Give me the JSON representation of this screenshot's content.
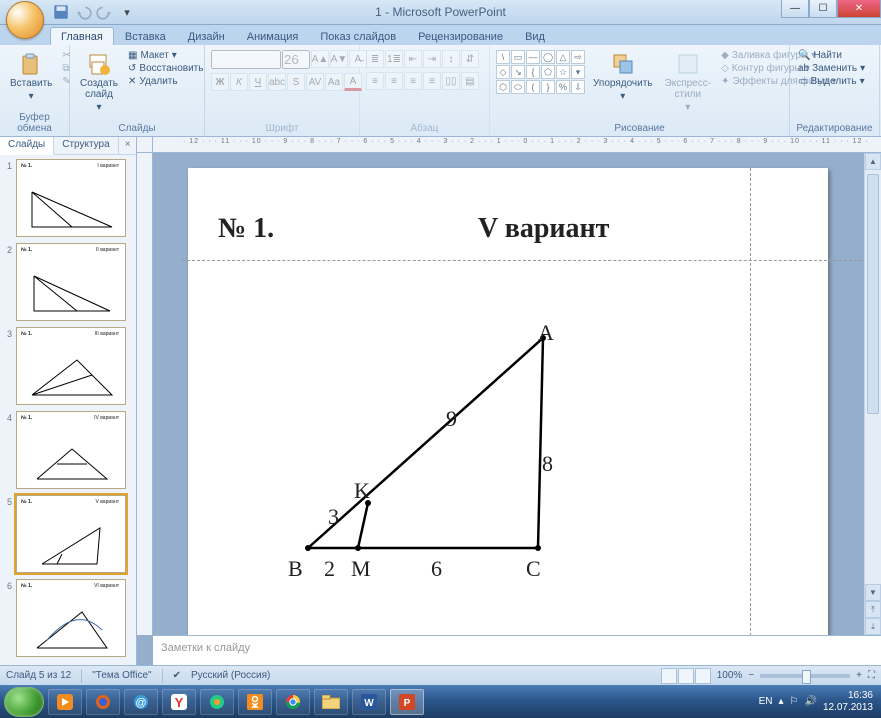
{
  "app": {
    "title": "1 - Microsoft PowerPoint"
  },
  "tabs": {
    "items": [
      "Главная",
      "Вставка",
      "Дизайн",
      "Анимация",
      "Показ слайдов",
      "Рецензирование",
      "Вид"
    ],
    "active": 0
  },
  "ribbon": {
    "clipboard": {
      "label": "Буфер обмена",
      "paste": "Вставить"
    },
    "slides": {
      "label": "Слайды",
      "create": "Создать\nслайд",
      "layout": "Макет",
      "reset": "Восстановить",
      "delete": "Удалить"
    },
    "font": {
      "label": "Шрифт",
      "name_placeholder": "",
      "size_placeholder": "26"
    },
    "para": {
      "label": "Абзац"
    },
    "drawing": {
      "label": "Рисование",
      "arrange": "Упорядочить",
      "styles": "Экспресс-стили",
      "fill": "Заливка фигуры",
      "outline": "Контур фигуры",
      "effects": "Эффекты для фигур"
    },
    "editing": {
      "label": "Редактирование",
      "find": "Найти",
      "replace": "Заменить",
      "select": "Выделить"
    }
  },
  "panel": {
    "tab_slides": "Слайды",
    "tab_structure": "Структура"
  },
  "thumbs": [
    {
      "num": "1",
      "title": "№ 1.",
      "variant": "I вариант"
    },
    {
      "num": "2",
      "title": "№ 1.",
      "variant": "II вариант"
    },
    {
      "num": "3",
      "title": "№ 1.",
      "variant": "III вариант"
    },
    {
      "num": "4",
      "title": "№ 1.",
      "variant": "IV вариант"
    },
    {
      "num": "5",
      "title": "№ 1.",
      "variant": "V вариант"
    },
    {
      "num": "6",
      "title": "№ 1.",
      "variant": "VI вариант"
    }
  ],
  "slide": {
    "heading": "№ 1.",
    "variant": "V вариант",
    "points": {
      "A": "A",
      "B": "B",
      "C": "C",
      "K": "K",
      "M": "M"
    },
    "values": {
      "AK": "9",
      "KB": "3",
      "BM": "2",
      "MC": "6",
      "AC": "8"
    }
  },
  "ruler": {
    "marks": "· 12 · · · 11 · · · 10 · · · 9 · · · 8 · · · 7 · · · 6 · · · 5 · · · 4 · · · 3 · · · 2 · · · 1 · · · 0 · · · 1 · · · 2 · · · 3 · · · 4 · · · 5 · · · 6 · · · 7 · · · 8 · · · 9 · · · 10 · · · 11 · · · 12 ·"
  },
  "notes": {
    "placeholder": "Заметки к слайду"
  },
  "status": {
    "slide": "Слайд 5 из 12",
    "theme": "\"Тема Office\"",
    "lang": "Русский (Россия)",
    "zoom": "100%"
  },
  "tray": {
    "lang": "EN",
    "time": "16:36",
    "date": "12.07.2013"
  }
}
